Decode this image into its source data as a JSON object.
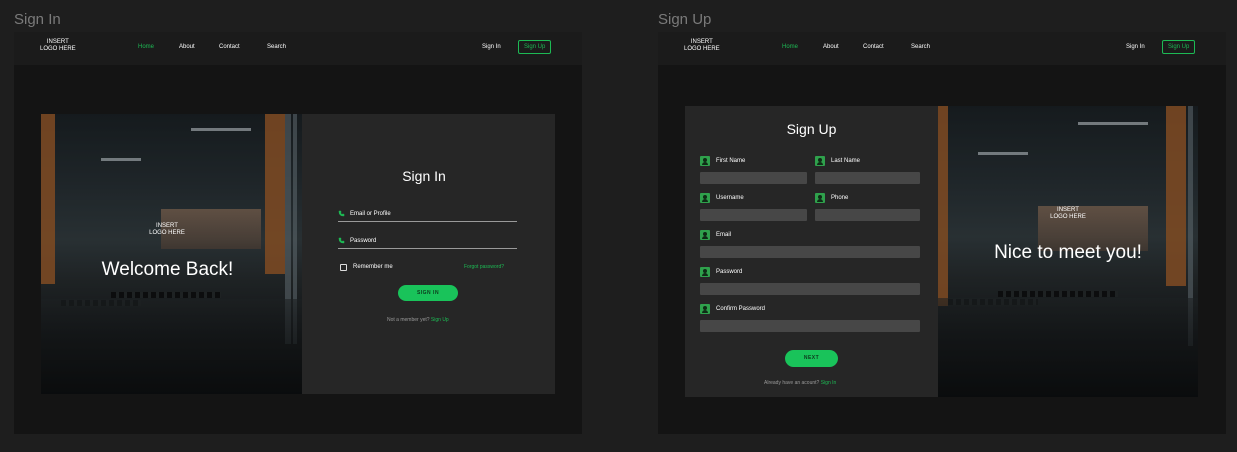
{
  "frames": {
    "signin_title": "Sign In",
    "signup_title": "Sign Up"
  },
  "nav": {
    "logo_line1": "INSERT",
    "logo_line2": "LOGO HERE",
    "links": [
      "Home",
      "About",
      "Contact",
      "Search"
    ],
    "sign_in": "Sign In",
    "sign_up": "Sign Up"
  },
  "signin": {
    "photo_logo_line1": "INSERT",
    "photo_logo_line2": "LOGO HERE",
    "welcome": "Welcome Back!",
    "title": "Sign In",
    "email_placeholder": "Email or Profile",
    "password_placeholder": "Password",
    "remember_me": "Remember me",
    "forgot": "Forgot password?",
    "button": "SIGN IN",
    "not_member": "Not a member yet?",
    "signup_link": "Sign Up"
  },
  "signup": {
    "title": "Sign Up",
    "first_name": "First Name",
    "last_name": "Last Name",
    "username": "Username",
    "phone": "Phone",
    "email": "Email",
    "password": "Password",
    "confirm_password": "Confirm Password",
    "button": "NEXT",
    "have_account": "Already have an acount?",
    "signin_link": "Sign In",
    "photo_logo_line1": "INSERT",
    "photo_logo_line2": "LOGO HERE",
    "nice": "Nice to meet you!"
  },
  "colors": {
    "accent": "#1db954",
    "button": "#19c35a",
    "background": "#1e1e1e",
    "panel": "#262626"
  }
}
